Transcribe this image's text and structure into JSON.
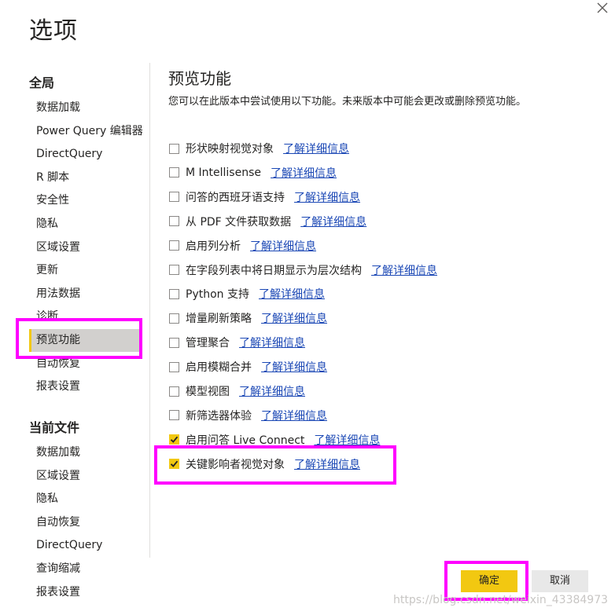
{
  "dialog": {
    "title": "选项"
  },
  "sidebar": {
    "global_header": "全局",
    "global_items": [
      "数据加载",
      "Power Query 编辑器",
      "DirectQuery",
      "R 脚本",
      "安全性",
      "隐私",
      "区域设置",
      "更新",
      "用法数据",
      "诊断",
      "预览功能",
      "自动恢复",
      "报表设置"
    ],
    "selected_item": "预览功能",
    "file_header": "当前文件",
    "file_items": [
      "数据加载",
      "区域设置",
      "隐私",
      "自动恢复",
      "DirectQuery",
      "查询缩减",
      "报表设置"
    ]
  },
  "main": {
    "title": "预览功能",
    "description": "您可以在此版本中尝试使用以下功能。未来版本中可能会更改或删除预览功能。",
    "link_text": "了解详细信息",
    "options": [
      {
        "label": "形状映射视觉对象",
        "checked": false
      },
      {
        "label": "M Intellisense",
        "checked": false
      },
      {
        "label": "问答的西班牙语支持",
        "checked": false
      },
      {
        "label": "从 PDF 文件获取数据",
        "checked": false
      },
      {
        "label": "启用列分析",
        "checked": false
      },
      {
        "label": "在字段列表中将日期显示为层次结构",
        "checked": false
      },
      {
        "label": "Python 支持",
        "checked": false
      },
      {
        "label": "增量刷新策略",
        "checked": false
      },
      {
        "label": "管理聚合",
        "checked": false
      },
      {
        "label": "启用模糊合并",
        "checked": false
      },
      {
        "label": "模型视图",
        "checked": false
      },
      {
        "label": "新筛选器体验",
        "checked": false
      },
      {
        "label": "启用问答 Live Connect",
        "checked": true
      },
      {
        "label": "关键影响者视觉对象",
        "checked": true
      }
    ]
  },
  "buttons": {
    "ok": "确定",
    "cancel": "取消"
  },
  "watermark": "https://blog.csdn.net/weixin_43384973",
  "colors": {
    "accent": "#f2c811",
    "highlight": "#ff00ff",
    "link": "#1a47b5"
  }
}
